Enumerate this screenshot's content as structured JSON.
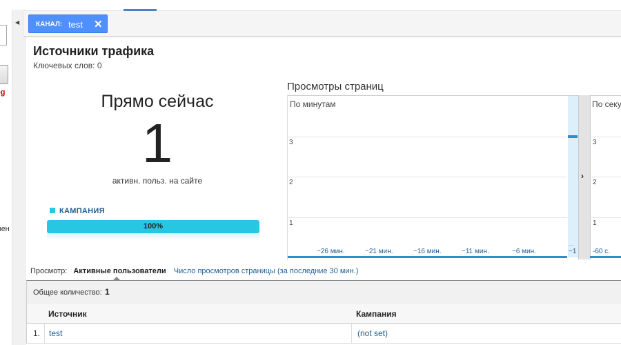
{
  "left": {
    "red_text": "og",
    "partial_text": "мен"
  },
  "filter": {
    "key": "КАНАЛ:",
    "value": "test",
    "close": "✕"
  },
  "header": {
    "title": "Источники трафика",
    "subtitle": "Ключевых слов: 0"
  },
  "right_now": {
    "title": "Прямо сейчас",
    "count": "1",
    "caption": "активн. польз. на сайте",
    "campaign_label": "КАМПАНИЯ",
    "campaign_percent": "100%",
    "campaign_fraction": 1.0,
    "accent": "#25c7e3"
  },
  "pageviews": {
    "title": "Просмотры страниц",
    "per_minute": {
      "label": "По минутам",
      "y_ticks": [
        "3",
        "2",
        "1"
      ],
      "x_ticks": [
        "−26 мин.",
        "−21 мин.",
        "−16 мин.",
        "−11 мин.",
        "−6 мин.",
        "−1"
      ]
    },
    "per_second": {
      "label": "По секу",
      "y_ticks": [
        "3",
        "2",
        "1"
      ],
      "x_tick": "-60 с."
    },
    "divider_arrow": "›"
  },
  "view": {
    "label": "Просмотр:",
    "active": "Активные пользователи",
    "link": "Число просмотров страницы (за последние 30 мин.)"
  },
  "table": {
    "total_label": "Общее количество:",
    "total_value": "1",
    "columns": [
      "Источник",
      "Кампания"
    ],
    "rows": [
      {
        "num": "1.",
        "source": "test",
        "campaign": "(not set)"
      }
    ]
  }
}
